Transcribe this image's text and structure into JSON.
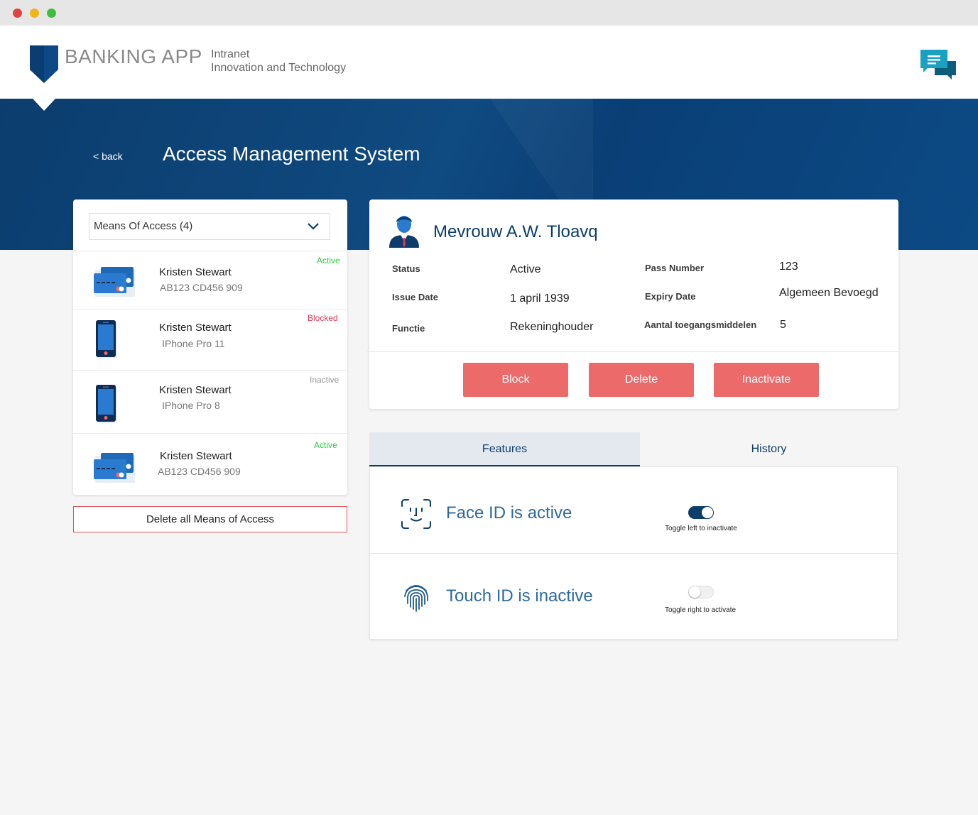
{
  "header": {
    "brand": "BANKING APP",
    "subtitle_line1": "Intranet",
    "subtitle_line2": "Innovation and Technology",
    "chat_icon": "chat-bubbles-icon"
  },
  "hero": {
    "back_label": "< back",
    "title": "Access Management System"
  },
  "means": {
    "dropdown_label": "Means Of Access (4)",
    "items": [
      {
        "name": "Kristen Stewart",
        "detail": "AB123 CD456 909",
        "status": "Active",
        "type": "card"
      },
      {
        "name": "Kristen Stewart",
        "detail": "IPhone Pro 11",
        "status": "Blocked",
        "type": "phone"
      },
      {
        "name": "Kristen Stewart",
        "detail": "IPhone Pro 8",
        "status": "Inactive",
        "type": "phone"
      },
      {
        "name": "Kristen Stewart",
        "detail": "AB123 CD456 909",
        "status": "Active",
        "type": "card"
      }
    ],
    "delete_all_label": "Delete all Means of Access"
  },
  "person": {
    "name": "Mevrouw A.W. Tloavq",
    "fields": {
      "status_label": "Status",
      "status_value": "Active",
      "issue_label": "Issue Date",
      "issue_value": "1 april 1939",
      "functie_label": "Functie",
      "functie_value": "Rekeninghouder",
      "pass_label": "Pass Number",
      "pass_value": "123",
      "expiry_label": "Expiry Date",
      "expiry_value": "Algemeen Bevoegd",
      "aantal_label": "Aantal toegangsmiddelen",
      "aantal_value": "5"
    },
    "actions": {
      "block": "Block",
      "delete": "Delete",
      "inactivate": "Inactivate"
    }
  },
  "tabs": {
    "features": "Features",
    "history": "History"
  },
  "features": {
    "face": {
      "title": "Face ID is active",
      "hint": "Toggle left to inactivate",
      "enabled": true
    },
    "touch": {
      "title": "Touch ID is inactive",
      "hint": "Toggle right to activate",
      "enabled": false
    }
  },
  "colors": {
    "brand_navy": "#0d3d6b",
    "accent_red": "#ec6a6a",
    "status_active": "#2ecc40",
    "status_blocked": "#e0344f",
    "status_inactive": "#999999"
  }
}
